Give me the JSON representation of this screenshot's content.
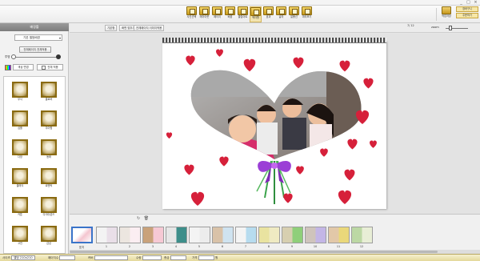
{
  "colors": {
    "accent": "#d9b54a",
    "selection": "#3a74c9",
    "heart": "#d6203a",
    "statusbar": "#ede2a8"
  },
  "titlebar": {
    "buttons": [
      "_",
      "□",
      "×"
    ]
  },
  "toolbar": {
    "tools": [
      {
        "label": "사진선택",
        "icon": "photo-select-icon"
      },
      {
        "label": "레이아웃",
        "icon": "layout-icon"
      },
      {
        "label": "페이지",
        "icon": "page-icon"
      },
      {
        "label": "배경",
        "icon": "background-icon"
      },
      {
        "label": "클립아트",
        "icon": "clipart-icon"
      },
      {
        "label": "액자틀",
        "icon": "frame-icon"
      },
      {
        "label": "효과",
        "icon": "effect-icon"
      },
      {
        "label": "글자",
        "icon": "text-icon"
      },
      {
        "label": "말풍선",
        "icon": "balloon-icon"
      },
      {
        "label": "미리보기",
        "icon": "preview-icon"
      }
    ],
    "right": [
      {
        "label": "작업저장",
        "icon": "save-icon"
      },
      {
        "label": "장바구니",
        "icon": "cart-icon"
      },
      {
        "label": "주문하기",
        "icon": "order-icon"
      }
    ]
  },
  "left_panel": {
    "header": "배경틀",
    "bg_select": "기본 앨범배경",
    "apply_all_bg": "전체페이지 전체적용",
    "opacity_label": "투명",
    "color_change": "색상 변경",
    "apply_all_color": "전체 적용",
    "frames": [
      [
        "무늬",
        "클로버"
      ],
      [
        "심플",
        "우아함"
      ],
      [
        "다방",
        "동화"
      ],
      [
        "클래식",
        "로맨틱"
      ],
      [
        "카툰",
        "다이아몬드"
      ],
      [
        "고전",
        "감성"
      ]
    ]
  },
  "canvas_toolbar": {
    "view_label": "기본형",
    "fit_label": "화면 맞추기",
    "apply_all_pages": "전체페이지 이미지적용",
    "page_label": "7",
    "page_total": "/ 12",
    "zoom_label": "zoom"
  },
  "filmstrip": {
    "tools": [
      "↻",
      "🗑"
    ],
    "pages": [
      "표지",
      "1",
      "2",
      "3",
      "4",
      "5",
      "6",
      "7",
      "8",
      "9",
      "10",
      "11",
      "12"
    ]
  },
  "statusbar": {
    "size_label": "사이즈",
    "size_value": "앨범 210x210",
    "paper_label": "페이지수",
    "paper_value": "",
    "cover_label": "커버",
    "cover_value": "",
    "qty_label": "수량",
    "qty_value": "",
    "unit_label": "총금",
    "unit_value": "",
    "price_label": "가격",
    "price_value": "",
    "currency": "원"
  }
}
